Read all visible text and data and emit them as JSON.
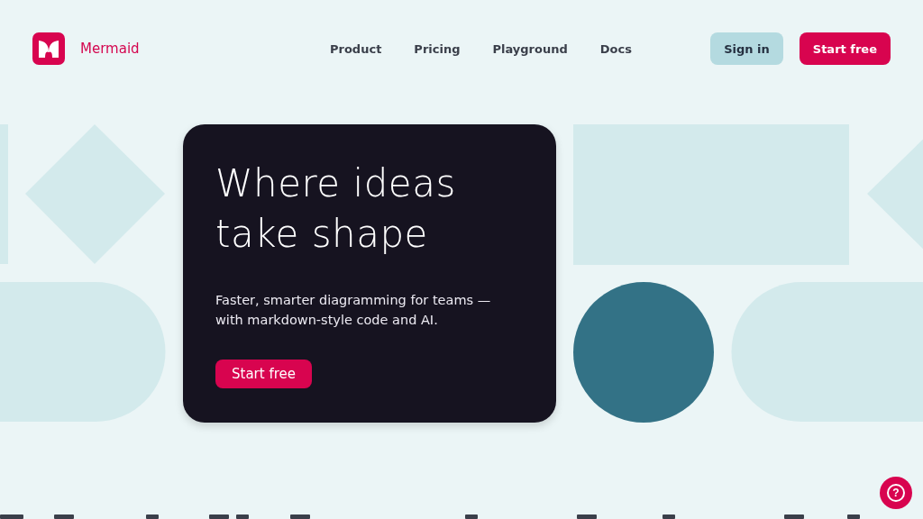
{
  "brand": {
    "name": "Mermaid"
  },
  "nav": [
    "Product",
    "Pricing",
    "Playground",
    "Docs"
  ],
  "actions": {
    "sign_in": "Sign in",
    "start": "Start free"
  },
  "hero": {
    "title_lines": [
      "Where ideas",
      "take shape"
    ],
    "subtitle": "Faster, smarter diagramming for teams — with markdown-style code and AI.",
    "cta": "Start free"
  },
  "help": {
    "label": "?"
  }
}
